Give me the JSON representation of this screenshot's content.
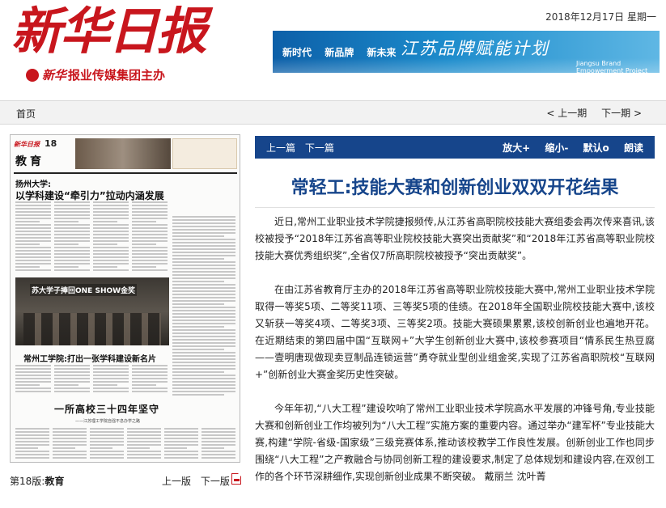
{
  "header": {
    "logo_title": "新华日报",
    "logo_brand": "新华",
    "logo_sub": "报业传媒集团主办",
    "date": "2018年12月17日 星期一",
    "banner": {
      "slogans": [
        "新时代",
        "新品牌",
        "新未来"
      ],
      "plan_cn": "江苏品牌赋能计划",
      "plan_en": "Jiangsu Brand Empowerment Project"
    }
  },
  "nav": {
    "home": "首页",
    "prev_issue": "< 上一期",
    "next_issue": "下一期 >"
  },
  "paper": {
    "masthead": "新华日报",
    "page_no": "18",
    "section": "教育",
    "kicker": "扬州大学:",
    "headline1": "以学科建设“牵引力”拉动内涵发展",
    "photo_caption": "苏大学子捧回ONE SHOW金奖",
    "headline3": "常州工学院:打出一张学科建设新名片",
    "headline4": "一所高校三十四年坚守",
    "sub4": "——江苏理工学院自强不息办学之路"
  },
  "page_footer": {
    "label_prefix": "第18版:",
    "label_name": "教育",
    "prev_page": "上一版",
    "next_page": "下一版"
  },
  "article": {
    "prev": "上一篇",
    "next": "下一篇",
    "tools": [
      "放大+",
      "缩小-",
      "默认o",
      "朗读"
    ],
    "title": "常轻工:技能大赛和创新创业双双开花结果",
    "paragraphs": [
      "近日,常州工业职业技术学院捷报频传,从江苏省高职院校技能大赛组委会再次传来喜讯,该校被授予“2018年江苏省高等职业院校技能大赛突出贡献奖”和“2018年江苏省高等职业院校技能大赛优秀组织奖”,全省仅7所高职院校被授予“突出贡献奖”。",
      "在由江苏省教育厅主办的2018年江苏省高等职业院校技能大赛中,常州工业职业技术学院取得一等奖5项、二等奖11项、三等奖5项的佳绩。在2018年全国职业院校技能大赛中,该校又斩获一等奖4项、二等奖3项、三等奖2项。技能大赛硕果累累,该校创新创业也遍地开花。在近期结束的第四届中国“互联网+”大学生创新创业大赛中,该校参赛项目“情系民生热豆腐——壹明唐现做现卖豆制品连锁运营”勇夺就业型创业组金奖,实现了江苏省高职院校“互联网+”创新创业大赛金奖历史性突破。",
      "今年年初,“八大工程”建设吹响了常州工业职业技术学院高水平发展的冲锋号角,专业技能大赛和创新创业工作均被列为“八大工程”实施方案的重要内容。通过举办“建军杯”专业技能大赛,构建“学院-省级-国家级”三级竞赛体系,推动该校教学工作良性发展。创新创业工作也同步围绕“八大工程”之产教融合与协同创新工程的建设要求,制定了总体规划和建设内容,在双创工作的各个环节深耕细作,实现创新创业成果不断突破。 戴丽兰 沈叶菁"
    ]
  },
  "colors": {
    "brand_red": "#c8161d",
    "article_blue": "#16458b"
  }
}
